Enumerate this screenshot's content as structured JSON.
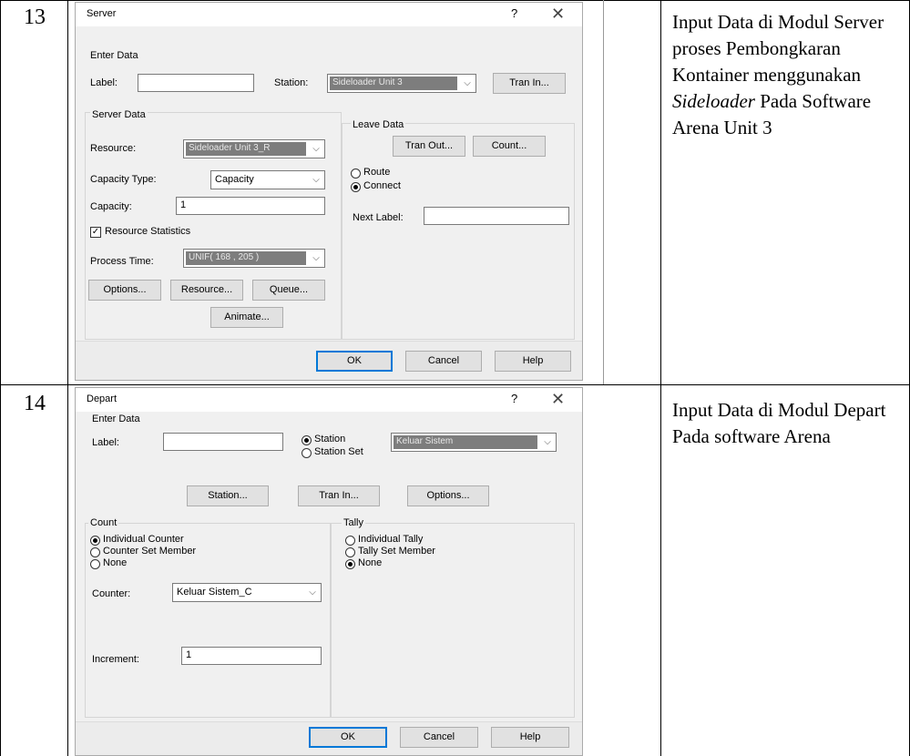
{
  "rows": [
    {
      "number": "13",
      "description_parts": [
        "Input Data di Modul Server proses Pembongkaran Kontainer menggunakan ",
        "Sideloader",
        " Pada Software Arena Unit 3"
      ],
      "dialog": {
        "title": "Server",
        "help": "?",
        "close": "✕",
        "enter_data": "Enter Data",
        "label_label": "Label:",
        "label_value": "",
        "station_label": "Station:",
        "station_value": "Sideloader Unit 3",
        "tran_in": "Tran In...",
        "server_data": "Server Data",
        "resource_label": "Resource:",
        "resource_value": "Sideloader Unit 3_R",
        "capacity_type_label": "Capacity Type:",
        "capacity_type_value": "Capacity",
        "capacity_label": "Capacity:",
        "capacity_value": "1",
        "resource_statistics": "Resource Statistics",
        "process_time_label": "Process Time:",
        "process_time_value": "UNIF( 168 , 205 )",
        "options": "Options...",
        "resource_btn": "Resource...",
        "queue": "Queue...",
        "animate": "Animate...",
        "leave_data": "Leave Data",
        "tran_out": "Tran Out...",
        "count": "Count...",
        "route": "Route",
        "connect": "Connect",
        "next_label": "Next Label:",
        "next_label_value": "",
        "ok": "OK",
        "cancel": "Cancel",
        "help_btn": "Help"
      }
    },
    {
      "number": "14",
      "description": "Input Data di Modul Depart Pada software Arena",
      "dialog": {
        "title": "Depart",
        "help": "?",
        "close": "✕",
        "enter_data": "Enter Data",
        "label_label": "Label:",
        "label_value": "",
        "station_radio": "Station",
        "station_set_radio": "Station Set",
        "station_value": "Keluar Sistem",
        "station_btn": "Station...",
        "tran_in": "Tran In...",
        "options": "Options...",
        "count": "Count",
        "individual_counter": "Individual Counter",
        "counter_set_member": "Counter Set Member",
        "none_count": "None",
        "counter_label": "Counter:",
        "counter_value": "Keluar Sistem_C",
        "increment_label": "Increment:",
        "increment_value": "1",
        "tally": "Tally",
        "individual_tally": "Individual Tally",
        "tally_set_member": "Tally Set Member",
        "none_tally": "None",
        "ok": "OK",
        "cancel": "Cancel",
        "help_btn": "Help"
      }
    }
  ]
}
